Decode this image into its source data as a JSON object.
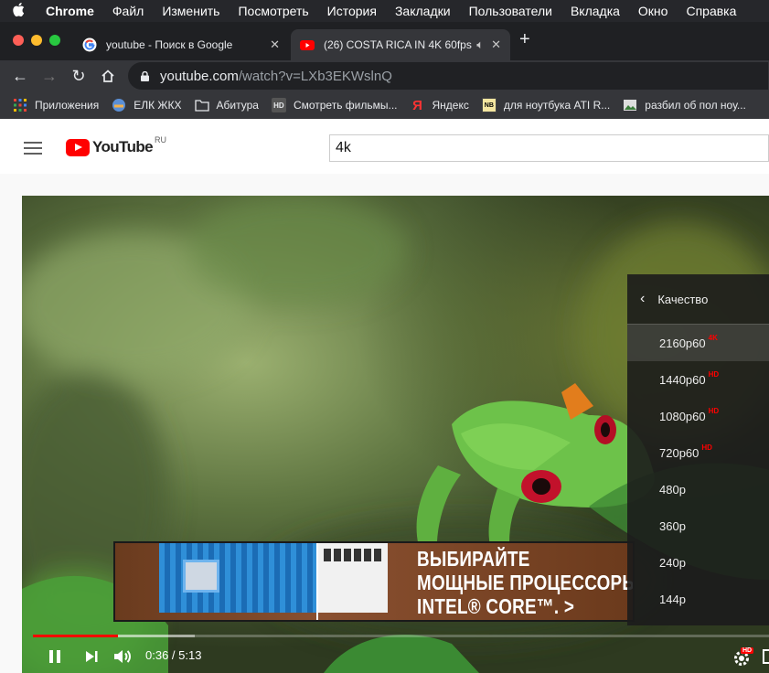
{
  "menubar": {
    "items": [
      "Chrome",
      "Файл",
      "Изменить",
      "Посмотреть",
      "История",
      "Закладки",
      "Пользователи",
      "Вкладка",
      "Окно",
      "Справка"
    ]
  },
  "tabs": [
    {
      "title": "youtube - Поиск в Google",
      "active": false
    },
    {
      "title": "(26) COSTA RICA IN 4K 60fps",
      "active": true
    }
  ],
  "address": {
    "host": "youtube.com",
    "path": "/watch?v=LXb3EKWslnQ"
  },
  "bookmarks": [
    {
      "label": "Приложения",
      "icon": "apps-grid-icon"
    },
    {
      "label": "ЕЛК ЖКХ",
      "icon": "elk-icon"
    },
    {
      "label": "Абитура",
      "icon": "folder-icon"
    },
    {
      "label": "Смотреть фильмы...",
      "icon": "hd-icon"
    },
    {
      "label": "Яндекс",
      "icon": "yandex-icon"
    },
    {
      "label": "для ноутбука ATI R...",
      "icon": "site-icon"
    },
    {
      "label": "разбил об пол ноу...",
      "icon": "image-icon"
    }
  ],
  "youtube": {
    "logo_text": "YouTube",
    "region": "RU",
    "search_value": "4k"
  },
  "ad": {
    "line1": "ВЫБИРАЙТЕ",
    "line2": "МОЩНЫЕ ПРОЦЕССОРЫ",
    "line3": "INTEL® CORE™. >"
  },
  "quality_menu": {
    "title": "Качество",
    "options": [
      {
        "label": "2160p60",
        "badge": "4K",
        "selected": true
      },
      {
        "label": "1440p60",
        "badge": "HD",
        "selected": false
      },
      {
        "label": "1080p60",
        "badge": "HD",
        "selected": false
      },
      {
        "label": "720p60",
        "badge": "HD",
        "selected": false
      },
      {
        "label": "480p",
        "badge": "",
        "selected": false
      },
      {
        "label": "360p",
        "badge": "",
        "selected": false
      },
      {
        "label": "240p",
        "badge": "",
        "selected": false
      },
      {
        "label": "144p",
        "badge": "",
        "selected": false
      }
    ]
  },
  "player": {
    "time": "0:36 / 5:13",
    "played_fraction": 0.115,
    "buffered_fraction": 0.22,
    "settings_badge": "HD"
  },
  "colors": {
    "accent": "#ff0000",
    "chrome_dark": "#35363a"
  }
}
